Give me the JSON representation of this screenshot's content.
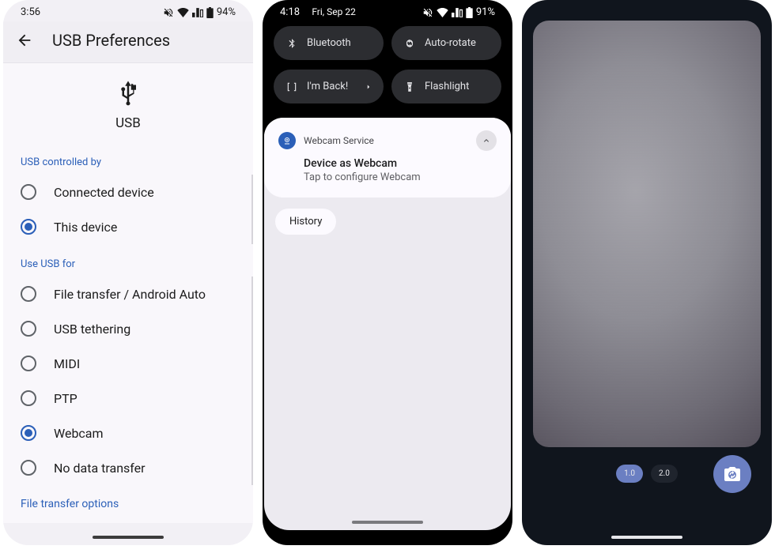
{
  "phone1": {
    "status": {
      "time": "3:56",
      "battery": "94%"
    },
    "header_title": "USB Preferences",
    "hero_label": "USB",
    "section_controlled": "USB controlled by",
    "controlled_options": [
      {
        "label": "Connected device",
        "selected": false
      },
      {
        "label": "This device",
        "selected": true
      }
    ],
    "section_use": "Use USB for",
    "use_options": [
      {
        "label": "File transfer / Android Auto",
        "selected": false
      },
      {
        "label": "USB tethering",
        "selected": false
      },
      {
        "label": "MIDI",
        "selected": false
      },
      {
        "label": "PTP",
        "selected": false
      },
      {
        "label": "Webcam",
        "selected": true
      },
      {
        "label": "No data transfer",
        "selected": false
      }
    ],
    "footer_link": "File transfer options"
  },
  "phone2": {
    "status": {
      "time": "4:18",
      "date": "Fri, Sep 22",
      "battery": "91%"
    },
    "qs": [
      {
        "label": "Bluetooth",
        "icon": "bluetooth"
      },
      {
        "label": "Auto-rotate",
        "icon": "rotate"
      },
      {
        "label": "I'm Back!",
        "icon": "bracket",
        "chevron": true
      },
      {
        "label": "Flashlight",
        "icon": "flashlight"
      }
    ],
    "notif": {
      "app": "Webcam Service",
      "title": "Device as Webcam",
      "subtitle": "Tap to configure Webcam"
    },
    "history_label": "History"
  },
  "phone3": {
    "zoom": [
      {
        "label": "1.0",
        "active": true
      },
      {
        "label": "2.0",
        "active": false
      }
    ]
  },
  "colors": {
    "accent_blue": "#2b5fb8",
    "qs_tile": "#2c2d31",
    "cam_accent": "#6b7fc2"
  }
}
